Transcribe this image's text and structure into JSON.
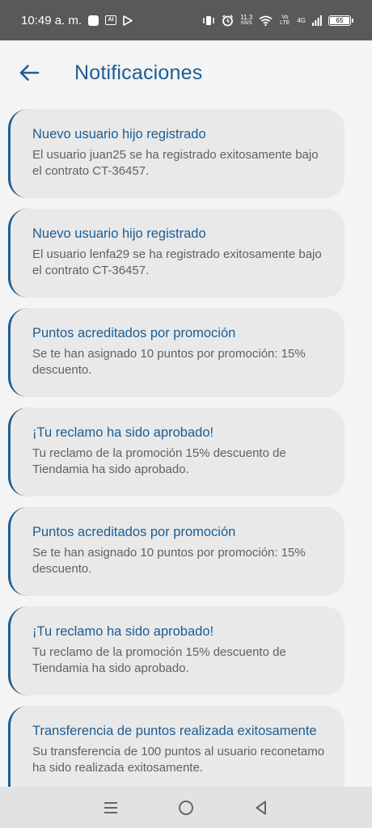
{
  "status_bar": {
    "time": "10:49 a. m.",
    "ai_label": "AI",
    "net_speed_value": "11.3",
    "net_speed_unit": "KB/S",
    "volte_label": "Vo LTE",
    "signal_label": "4G",
    "battery": "65"
  },
  "header": {
    "title": "Notificaciones"
  },
  "notifications": [
    {
      "title": "Nuevo usuario hijo registrado",
      "body": "El usuario juan25 se ha registrado exitosamente bajo el contrato CT-36457."
    },
    {
      "title": "Nuevo usuario hijo registrado",
      "body": "El usuario lenfa29 se ha registrado exitosamente bajo el contrato CT-36457."
    },
    {
      "title": "Puntos acreditados por promoción",
      "body": "Se te han asignado 10 puntos por promoción: 15% descuento."
    },
    {
      "title": "¡Tu reclamo ha sido aprobado!",
      "body": "Tu reclamo de la promoción 15% descuento de Tiendamia ha sido aprobado."
    },
    {
      "title": "Puntos acreditados por promoción",
      "body": "Se te han asignado 10 puntos por promoción: 15% descuento."
    },
    {
      "title": "¡Tu reclamo ha sido aprobado!",
      "body": "Tu reclamo de la promoción 15% descuento de Tiendamia ha sido aprobado."
    },
    {
      "title": "Transferencia de puntos realizada exitosamente",
      "body": "Su transferencia de 100 puntos al usuario reconetamo ha sido realizada exitosamente."
    }
  ],
  "colors": {
    "accent": "#1c5d93",
    "card_bg": "#e9e9e9",
    "page_bg": "#f4f4f4",
    "status_bar_bg": "#595959"
  },
  "icons": {
    "back": "arrow-left-icon",
    "nav_recents": "menu-lines-icon",
    "nav_home": "circle-home-icon",
    "nav_back": "triangle-back-icon"
  }
}
